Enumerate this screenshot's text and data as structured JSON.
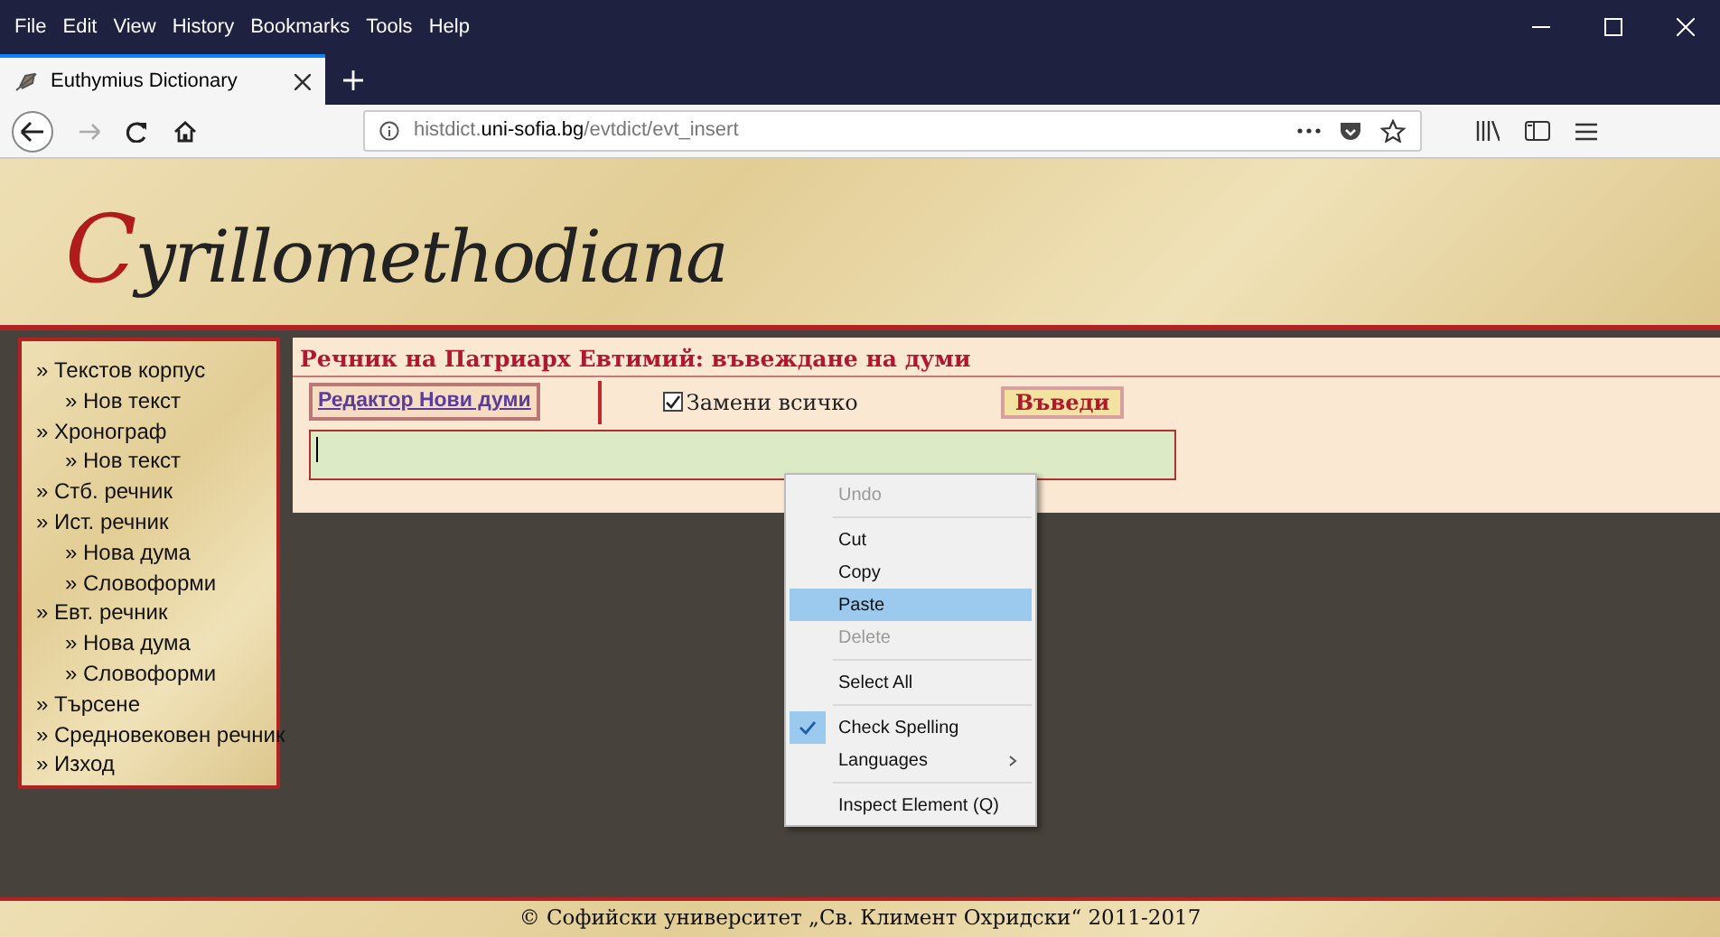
{
  "menu_bar": [
    "File",
    "Edit",
    "View",
    "History",
    "Bookmarks",
    "Tools",
    "Help"
  ],
  "tabs": [
    {
      "label": "Euthymius Dictionary",
      "selected": true
    }
  ],
  "address_bar": {
    "host_prefix": "histdict.",
    "host": "uni-sofia.bg",
    "path": "/evtdict/evt_insert"
  },
  "logo": {
    "initial": "C",
    "rest": "yrillomethodiana"
  },
  "sidebar": {
    "items": [
      {
        "label": "Текстов корпус",
        "children": [
          {
            "label": "Нов текст"
          }
        ]
      },
      {
        "label": "Хронограф",
        "children": [
          {
            "label": "Нов текст"
          }
        ]
      },
      {
        "label": "Стб. речник"
      },
      {
        "label": "Ист. речник",
        "children": [
          {
            "label": "Нова дума"
          },
          {
            "label": "Словоформи"
          }
        ]
      },
      {
        "label": "Евт. речник",
        "children": [
          {
            "label": "Нова дума"
          },
          {
            "label": "Словоформи"
          }
        ]
      },
      {
        "label": "Търсене"
      },
      {
        "label": "Средновековен речник"
      },
      {
        "label": "Изход"
      }
    ]
  },
  "bullet": "»",
  "panel": {
    "title": "Речник на Патриарх Евтимий: въвеждане на думи",
    "editor_link": "Редактор Нови думи",
    "replace_all": {
      "label": "Замени всичко",
      "checked": true
    },
    "submit": "Въведи"
  },
  "context_menu": [
    {
      "label": "Undo",
      "disabled": true,
      "selected": false,
      "checked": false
    },
    {
      "kind": "separator"
    },
    {
      "label": "Cut",
      "disabled": false,
      "selected": false,
      "checked": false
    },
    {
      "label": "Copy",
      "disabled": false,
      "selected": false,
      "checked": false
    },
    {
      "label": "Paste",
      "disabled": false,
      "selected": true,
      "checked": false
    },
    {
      "label": "Delete",
      "disabled": true,
      "selected": false,
      "checked": false
    },
    {
      "kind": "separator"
    },
    {
      "label": "Select All",
      "disabled": false,
      "selected": false,
      "checked": false
    },
    {
      "kind": "separator"
    },
    {
      "label": "Check Spelling",
      "disabled": false,
      "selected": false,
      "checked": true
    },
    {
      "label": "Languages",
      "disabled": false,
      "selected": false,
      "checked": false,
      "submenu": true
    },
    {
      "kind": "separator"
    },
    {
      "label": "Inspect Element (Q)",
      "disabled": false,
      "selected": false,
      "checked": false
    }
  ],
  "footer": "© Софийски университет „Св. Климент Охридски“ 2011-2017"
}
